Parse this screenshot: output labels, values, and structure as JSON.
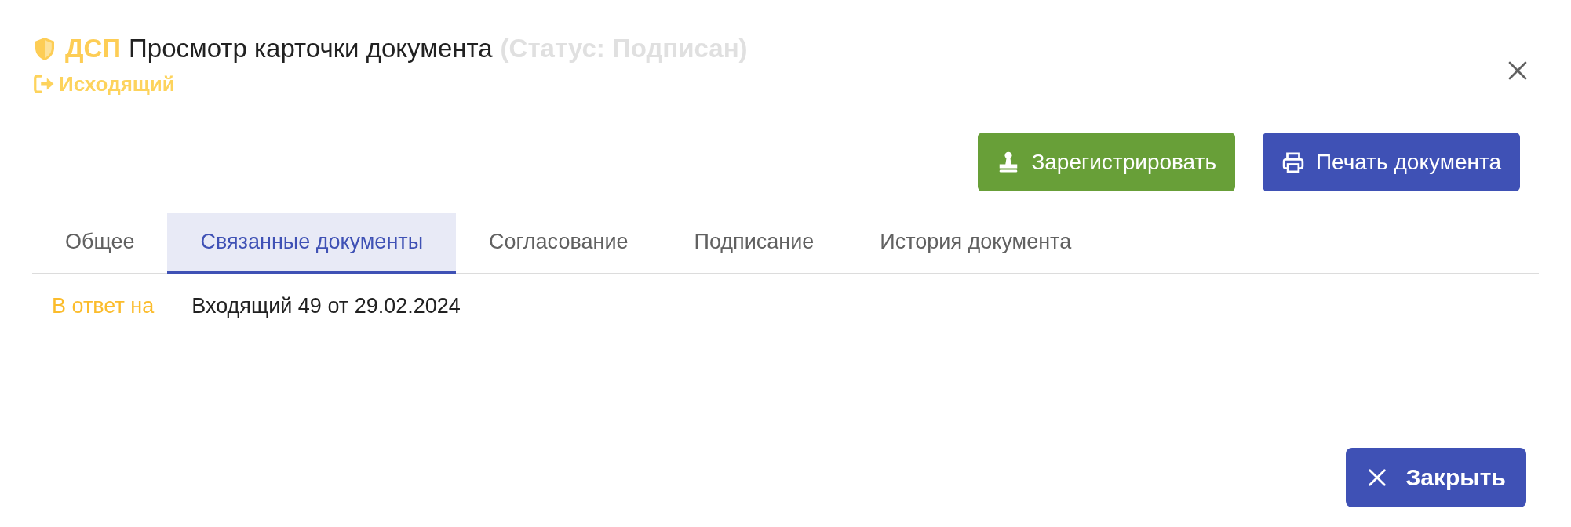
{
  "header": {
    "badge": "ДСП",
    "title": "Просмотр карточки документа",
    "status": "(Статус: Подписан)",
    "direction": "Исходящий"
  },
  "actions": [
    {
      "kind": "register",
      "label": "Зарегистрировать",
      "color": "#689f38"
    },
    {
      "kind": "print",
      "label": "Печать документа",
      "color": "#3f51b5"
    }
  ],
  "tabs": [
    {
      "label": "Общее",
      "selected": false
    },
    {
      "label": "Связанные документы",
      "selected": true
    },
    {
      "label": "Согласование",
      "selected": false
    },
    {
      "label": "Подписание",
      "selected": false
    },
    {
      "label": "История документа",
      "selected": false
    }
  ],
  "links": [
    {
      "label": "В ответ на",
      "value": "Входящий 49 от 29.02.2024"
    }
  ],
  "footer": {
    "close_label": "Закрыть"
  }
}
